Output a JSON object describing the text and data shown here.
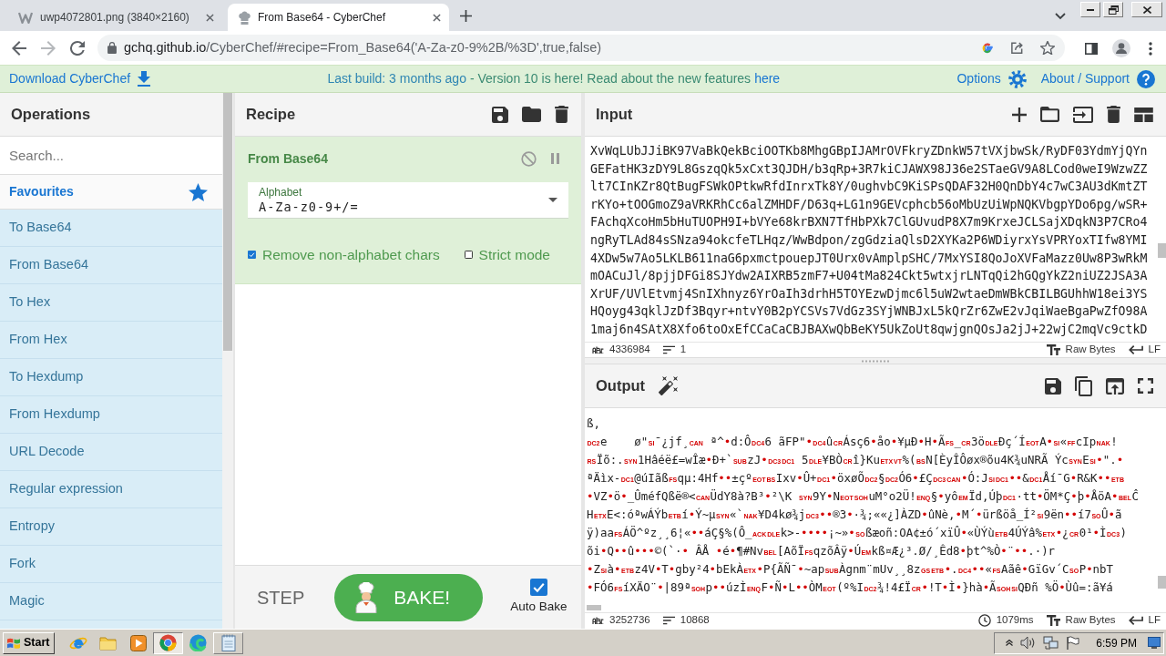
{
  "browser": {
    "tabs": [
      {
        "kind": "image",
        "title": "uwp4072801.png (3840×2160)",
        "selected": false
      },
      {
        "kind": "site",
        "title": "From Base64 - CyberChef",
        "selected": true
      }
    ],
    "address": {
      "host": "gchq.github.io",
      "path": "/CyberChef/#recipe=From_Base64('A-Za-z0-9%2B/%3D',true,false)"
    }
  },
  "banner": {
    "download": "Download CyberChef",
    "build": "Last build: 3 months ago",
    "notice": "- Version 10 is here! Read about the new features",
    "notice_link": "here",
    "options": "Options",
    "about": "About / Support"
  },
  "operations": {
    "title": "Operations",
    "search": {
      "placeholder": "Search..."
    },
    "favourites": "Favourites",
    "items": [
      "To Base64",
      "From Base64",
      "To Hex",
      "From Hex",
      "To Hexdump",
      "From Hexdump",
      "URL Decode",
      "Regular expression",
      "Entropy",
      "Fork",
      "Magic"
    ]
  },
  "recipe": {
    "title": "Recipe",
    "steps": [
      {
        "name": "From Base64",
        "args": [
          {
            "kind": "select",
            "label": "Alphabet",
            "value": "A-Za-z0-9+/="
          },
          {
            "kind": "checkbox",
            "label": "Remove non-alphabet chars",
            "checked": true
          },
          {
            "kind": "checkbox",
            "label": "Strict mode",
            "checked": false
          }
        ]
      }
    ],
    "step": "STEP",
    "bake": "BAKE!",
    "auto_bake": {
      "label": "Auto Bake",
      "checked": true
    }
  },
  "input": {
    "title": "Input",
    "lines": [
      "XvWqLUbJJiBK97VaBkQekBciOOTKb8MhgGBpIJAMrOVFkryZDnkW57tVXjbwSk/RyDF03YdmYjQYn",
      "GEFatHK3zDY9L8GszqQk5xCxt3QJDH/b3qRp+3R7kiCJAWX98J36e2STaeGV9A8LCod0weI9WzwZZ",
      "lt7CInKZr8QtBugFSWkOPtkwRfdInrxTk8Y/0ughvbC9KiSPsQDAF32H0QnDbY4c7wC3AU3dKmtZT",
      "rKYo+tOOGmoZ9aVRKRhCc6alZMHDF/D63q+LG1n9GEVcphcb56oMbUzUiWpNQKVbgpYDo6pg/wSR+",
      "FAchqXcoHm5bHuTUOPH9I+bVYe68krBXN7TfHbPXk7ClGUvudP8X7m9KrxeJCLSajXDqkN3P7CRo4",
      "ngRyTLAd84sSNza94okcfeTLHqz/WwBdpon/zgGdziaQlsD2XYKa2P6WDiyrxYsVPRYoxTIfw8YMI",
      "4XDw5w7Ao5LKLB611naG6pxmctpouepJT0Urx0vAmplpSHC/7MxYSI8QoJoXVFaMazz0Uw8P3wRkM",
      "mOACuJl/8pjjDFGi8SJYdw2AIXRB5zmF7+U04tMa824Ckt5wtxjrLNTqQi2hGQgYkZ2niUZ2JSA3A",
      "XrUF/UVlEtvmj4SnIXhnyz6YrOaIh3drhH5TOYEzwDjmc6l5uW2wtaeDmWBkCBILBGUhhW18ei3YS",
      "HQoyg43qklJzDf3Bqyr+ntvY0B2pYCSVs7VdGz3SYjWNBJxL5kQrZr6ZwE2vJqiWaeBgaPwZfO98A",
      "1maj6n4SAtX8Xfo6toOxEfCCaCaCBJBAXwQbBeKY5UkZoUt8qwjgnQOsJa2jJ+22wjC2mqVc9ctkD"
    ],
    "status": {
      "length": "4336984",
      "lines": "1",
      "format": "Raw Bytes",
      "eol": "LF"
    }
  },
  "output": {
    "title": "Output",
    "lines": [
      [
        {
          "kind": "text",
          "text": "ß,"
        }
      ],
      [
        {
          "kind": "ctl",
          "text": "DC2"
        },
        {
          "kind": "text",
          "text": "e    ø\""
        },
        {
          "kind": "ctl",
          "text": "SI"
        },
        {
          "kind": "text",
          "text": "¯¿jf¸"
        },
        {
          "kind": "ctl",
          "text": "CAN"
        },
        {
          "kind": "text",
          "text": " ª^"
        },
        {
          "kind": "dot",
          "text": "•"
        },
        {
          "kind": "text",
          "text": "d:Ô"
        },
        {
          "kind": "ctl",
          "text": "DC4"
        },
        {
          "kind": "text",
          "text": "6 ãFP\""
        },
        {
          "kind": "dot",
          "text": "•"
        },
        {
          "kind": "ctl",
          "text": "DC4"
        },
        {
          "kind": "text",
          "text": "û"
        },
        {
          "kind": "ctl",
          "text": "CR"
        },
        {
          "kind": "text",
          "text": "Ásç6"
        },
        {
          "kind": "dot",
          "text": "•"
        },
        {
          "kind": "text",
          "text": "åo"
        },
        {
          "kind": "dot",
          "text": "•"
        },
        {
          "kind": "text",
          "text": "¥µÐ"
        },
        {
          "kind": "dot",
          "text": "•"
        },
        {
          "kind": "text",
          "text": "H"
        },
        {
          "kind": "dot",
          "text": "•"
        },
        {
          "kind": "text",
          "text": "Ã"
        },
        {
          "kind": "ctl",
          "text": "FS"
        },
        {
          "kind": "text",
          "text": "_"
        },
        {
          "kind": "ctl",
          "text": "CR"
        },
        {
          "kind": "text",
          "text": "3ö"
        },
        {
          "kind": "ctl",
          "text": "DLE"
        },
        {
          "kind": "text",
          "text": "Ðç´Í"
        },
        {
          "kind": "ctl",
          "text": "EOT"
        },
        {
          "kind": "text",
          "text": "A"
        },
        {
          "kind": "dot",
          "text": "•"
        },
        {
          "kind": "ctl",
          "text": "SI"
        },
        {
          "kind": "text",
          "text": "«"
        },
        {
          "kind": "ctl",
          "text": "FF"
        },
        {
          "kind": "text",
          "text": "cIp"
        },
        {
          "kind": "ctl",
          "text": "NAK"
        },
        {
          "kind": "text",
          "text": "!"
        }
      ],
      [
        {
          "kind": "ctl",
          "text": "RS"
        },
        {
          "kind": "text",
          "text": "Ïõ:."
        },
        {
          "kind": "ctl",
          "text": "SYN"
        },
        {
          "kind": "text",
          "text": "1Hâéë£=wÎæ"
        },
        {
          "kind": "dot",
          "text": "•"
        },
        {
          "kind": "text",
          "text": "Ð+`"
        },
        {
          "kind": "ctl",
          "text": "SUB"
        },
        {
          "kind": "text",
          "text": "zJ"
        },
        {
          "kind": "dot",
          "text": "•"
        },
        {
          "kind": "ctl",
          "text": "DC3"
        },
        {
          "kind": "ctl",
          "text": "DC1"
        },
        {
          "kind": "text",
          "text": " 5"
        },
        {
          "kind": "ctl",
          "text": "DLE"
        },
        {
          "kind": "text",
          "text": "¥BÒ"
        },
        {
          "kind": "ctl",
          "text": "CR"
        },
        {
          "kind": "text",
          "text": "î}Ku"
        },
        {
          "kind": "ctl",
          "text": "ETX"
        },
        {
          "kind": "ctl",
          "text": "VT"
        },
        {
          "kind": "text",
          "text": "%("
        },
        {
          "kind": "ctl",
          "text": "BS"
        },
        {
          "kind": "text",
          "text": "N[ÈyÎÔøx®õu4K¾uNRÃ Ýc"
        },
        {
          "kind": "ctl",
          "text": "SYN"
        },
        {
          "kind": "text",
          "text": "E"
        },
        {
          "kind": "ctl",
          "text": "SI"
        },
        {
          "kind": "dot",
          "text": "•"
        },
        {
          "kind": "text",
          "text": "\"."
        },
        {
          "kind": "dot",
          "text": "•"
        }
      ],
      [
        {
          "kind": "text",
          "text": "ªÄìx-"
        },
        {
          "kind": "ctl",
          "text": "DC1"
        },
        {
          "kind": "text",
          "text": "@úIãß"
        },
        {
          "kind": "ctl",
          "text": "FS"
        },
        {
          "kind": "text",
          "text": "qµ:4Hf"
        },
        {
          "kind": "dot",
          "text": "••"
        },
        {
          "kind": "text",
          "text": "±çº"
        },
        {
          "kind": "ctl",
          "text": "EOT"
        },
        {
          "kind": "ctl",
          "text": "BS"
        },
        {
          "kind": "text",
          "text": "Ixv"
        },
        {
          "kind": "dot",
          "text": "•"
        },
        {
          "kind": "text",
          "text": "Û+"
        },
        {
          "kind": "ctl",
          "text": "DC1"
        },
        {
          "kind": "dot",
          "text": "•"
        },
        {
          "kind": "text",
          "text": "öxøÕ"
        },
        {
          "kind": "ctl",
          "text": "DC2"
        },
        {
          "kind": "text",
          "text": "§"
        },
        {
          "kind": "ctl",
          "text": "DC2"
        },
        {
          "kind": "text",
          "text": "Ó6"
        },
        {
          "kind": "dot",
          "text": "•"
        },
        {
          "kind": "text",
          "text": "£Ç"
        },
        {
          "kind": "ctl",
          "text": "DC3"
        },
        {
          "kind": "ctl",
          "text": "CAN"
        },
        {
          "kind": "dot",
          "text": "•"
        },
        {
          "kind": "text",
          "text": "Ó:J"
        },
        {
          "kind": "ctl",
          "text": "SI"
        },
        {
          "kind": "ctl",
          "text": "DC1"
        },
        {
          "kind": "dot",
          "text": "••"
        },
        {
          "kind": "text",
          "text": "&"
        },
        {
          "kind": "ctl",
          "text": "DC1"
        },
        {
          "kind": "text",
          "text": "Åí¯G"
        },
        {
          "kind": "dot",
          "text": "•"
        },
        {
          "kind": "text",
          "text": "R&K"
        },
        {
          "kind": "dot",
          "text": "••"
        },
        {
          "kind": "ctl",
          "text": "ETB"
        }
      ],
      [
        {
          "kind": "dot",
          "text": "•"
        },
        {
          "kind": "text",
          "text": "VZ"
        },
        {
          "kind": "dot",
          "text": "•"
        },
        {
          "kind": "text",
          "text": "ö"
        },
        {
          "kind": "dot",
          "text": "•"
        },
        {
          "kind": "text",
          "text": "_ÛméfQßë®<"
        },
        {
          "kind": "ctl",
          "text": "CAN"
        },
        {
          "kind": "text",
          "text": "ÜdY8à?B³"
        },
        {
          "kind": "dot",
          "text": "•"
        },
        {
          "kind": "text",
          "text": "²\\K "
        },
        {
          "kind": "ctl",
          "text": "SYN"
        },
        {
          "kind": "text",
          "text": "9Y"
        },
        {
          "kind": "dot",
          "text": "•"
        },
        {
          "kind": "text",
          "text": "N"
        },
        {
          "kind": "ctl",
          "text": "EOT"
        },
        {
          "kind": "ctl",
          "text": "SOH"
        },
        {
          "kind": "text",
          "text": "uM°o2Ü!"
        },
        {
          "kind": "ctl",
          "text": "ENQ"
        },
        {
          "kind": "text",
          "text": "§"
        },
        {
          "kind": "dot",
          "text": "•"
        },
        {
          "kind": "text",
          "text": "yô"
        },
        {
          "kind": "ctl",
          "text": "EM"
        },
        {
          "kind": "text",
          "text": "Ïd,Úþ"
        },
        {
          "kind": "ctl",
          "text": "DC1"
        },
        {
          "kind": "text",
          "text": "·tt"
        },
        {
          "kind": "dot",
          "text": "•"
        },
        {
          "kind": "text",
          "text": "ÖM*Ç"
        },
        {
          "kind": "dot",
          "text": "•"
        },
        {
          "kind": "text",
          "text": "þ"
        },
        {
          "kind": "dot",
          "text": "•"
        },
        {
          "kind": "text",
          "text": "ÅöA"
        },
        {
          "kind": "dot",
          "text": "•"
        },
        {
          "kind": "ctl",
          "text": "BEL"
        },
        {
          "kind": "text",
          "text": "Ĉ"
        }
      ],
      [
        {
          "kind": "text",
          "text": "H"
        },
        {
          "kind": "ctl",
          "text": "ETX"
        },
        {
          "kind": "text",
          "text": "E<:óªwÁÝb"
        },
        {
          "kind": "ctl",
          "text": "ETB"
        },
        {
          "kind": "text",
          "text": "í"
        },
        {
          "kind": "dot",
          "text": "•"
        },
        {
          "kind": "text",
          "text": "Ý~µ"
        },
        {
          "kind": "ctl",
          "text": "SYN"
        },
        {
          "kind": "text",
          "text": "«`"
        },
        {
          "kind": "ctl",
          "text": "NAK"
        },
        {
          "kind": "text",
          "text": "¥D4kø¾j"
        },
        {
          "kind": "ctl",
          "text": "DC3"
        },
        {
          "kind": "dot",
          "text": "••"
        },
        {
          "kind": "text",
          "text": "®3"
        },
        {
          "kind": "dot",
          "text": "•"
        },
        {
          "kind": "text",
          "text": "·¾;««¿]ÀZD"
        },
        {
          "kind": "dot",
          "text": "•"
        },
        {
          "kind": "text",
          "text": "ûNè,"
        },
        {
          "kind": "dot",
          "text": "•"
        },
        {
          "kind": "text",
          "text": "M´"
        },
        {
          "kind": "dot",
          "text": "•"
        },
        {
          "kind": "text",
          "text": "ürßöå_Í²"
        },
        {
          "kind": "ctl",
          "text": "SI"
        },
        {
          "kind": "text",
          "text": "9ën"
        },
        {
          "kind": "dot",
          "text": "••"
        },
        {
          "kind": "text",
          "text": "í7"
        },
        {
          "kind": "ctl",
          "text": "SO"
        },
        {
          "kind": "text",
          "text": "Û"
        },
        {
          "kind": "dot",
          "text": "•"
        },
        {
          "kind": "text",
          "text": "ã"
        }
      ],
      [
        {
          "kind": "text",
          "text": "ÿ)aa"
        },
        {
          "kind": "ctl",
          "text": "FS"
        },
        {
          "kind": "text",
          "text": "ÁÖ^ºz¸¸6¦«"
        },
        {
          "kind": "dot",
          "text": "••"
        },
        {
          "kind": "text",
          "text": "áÇ§%(Ô_"
        },
        {
          "kind": "ctl",
          "text": "ACK"
        },
        {
          "kind": "ctl",
          "text": "DLE"
        },
        {
          "kind": "text",
          "text": "k>-"
        },
        {
          "kind": "dot",
          "text": "••••"
        },
        {
          "kind": "text",
          "text": "¡~»"
        },
        {
          "kind": "dot",
          "text": "•"
        },
        {
          "kind": "ctl",
          "text": "SO"
        },
        {
          "kind": "text",
          "text": "ßæoñ:OA¢±ó´xïÛ"
        },
        {
          "kind": "dot",
          "text": "•"
        },
        {
          "kind": "text",
          "text": "«ÙÝù"
        },
        {
          "kind": "ctl",
          "text": "ETB"
        },
        {
          "kind": "text",
          "text": "4ÚÝâ%"
        },
        {
          "kind": "ctl",
          "text": "ETX"
        },
        {
          "kind": "dot",
          "text": "•"
        },
        {
          "kind": "text",
          "text": "¿"
        },
        {
          "kind": "ctl",
          "text": "CR"
        },
        {
          "kind": "text",
          "text": "0¹"
        },
        {
          "kind": "dot",
          "text": "•"
        },
        {
          "kind": "text",
          "text": "Ì"
        },
        {
          "kind": "ctl",
          "text": "DC3"
        },
        {
          "kind": "text",
          "text": ")"
        }
      ],
      [
        {
          "kind": "text",
          "text": "õi"
        },
        {
          "kind": "dot",
          "text": "•"
        },
        {
          "kind": "text",
          "text": "Q"
        },
        {
          "kind": "dot",
          "text": "••"
        },
        {
          "kind": "text",
          "text": "û"
        },
        {
          "kind": "dot",
          "text": "•••"
        },
        {
          "kind": "text",
          "text": "©(`·"
        },
        {
          "kind": "dot",
          "text": "•"
        },
        {
          "kind": "text",
          "text": " ÂÅ "
        },
        {
          "kind": "dot",
          "text": "•"
        },
        {
          "kind": "text",
          "text": "é"
        },
        {
          "kind": "dot",
          "text": "•"
        },
        {
          "kind": "text",
          "text": "¶#Nv"
        },
        {
          "kind": "ctl",
          "text": "BEL"
        },
        {
          "kind": "text",
          "text": "[AõÏ"
        },
        {
          "kind": "ctl",
          "text": "FS"
        },
        {
          "kind": "text",
          "text": "qzõÂÿ"
        },
        {
          "kind": "dot",
          "text": "•"
        },
        {
          "kind": "text",
          "text": "Ú"
        },
        {
          "kind": "ctl",
          "text": "EM"
        },
        {
          "kind": "text",
          "text": "kß¤Æ¿³.Ø/¸Êd8"
        },
        {
          "kind": "dot",
          "text": "•"
        },
        {
          "kind": "text",
          "text": "þt^%Ò"
        },
        {
          "kind": "dot",
          "text": "•"
        },
        {
          "kind": "text",
          "text": "¨"
        },
        {
          "kind": "dot",
          "text": "••"
        },
        {
          "kind": "text",
          "text": ".·)r"
        }
      ],
      [
        {
          "kind": "dot",
          "text": "•"
        },
        {
          "kind": "text",
          "text": "Z"
        },
        {
          "kind": "ctl",
          "text": "SI"
        },
        {
          "kind": "text",
          "text": "à"
        },
        {
          "kind": "dot",
          "text": "•"
        },
        {
          "kind": "ctl",
          "text": "ETB"
        },
        {
          "kind": "text",
          "text": "z4V"
        },
        {
          "kind": "dot",
          "text": "•"
        },
        {
          "kind": "text",
          "text": "T"
        },
        {
          "kind": "dot",
          "text": "•"
        },
        {
          "kind": "text",
          "text": "gby²4"
        },
        {
          "kind": "dot",
          "text": "•"
        },
        {
          "kind": "text",
          "text": "bEkÀ"
        },
        {
          "kind": "ctl",
          "text": "ETX"
        },
        {
          "kind": "dot",
          "text": "•"
        },
        {
          "kind": "text",
          "text": "P{ÃÑ¯"
        },
        {
          "kind": "dot",
          "text": "•"
        },
        {
          "kind": "text",
          "text": "~ap"
        },
        {
          "kind": "ctl",
          "text": "SUB"
        },
        {
          "kind": "text",
          "text": "Àgnm¨mUv¸¸8z"
        },
        {
          "kind": "ctl",
          "text": "GS"
        },
        {
          "kind": "ctl",
          "text": "ETB"
        },
        {
          "kind": "dot",
          "text": "•"
        },
        {
          "kind": "text",
          "text": "."
        },
        {
          "kind": "ctl",
          "text": "DC4"
        },
        {
          "kind": "dot",
          "text": "••"
        },
        {
          "kind": "text",
          "text": "«"
        },
        {
          "kind": "ctl",
          "text": "FS"
        },
        {
          "kind": "text",
          "text": "Aãê"
        },
        {
          "kind": "dot",
          "text": "•"
        },
        {
          "kind": "text",
          "text": "GïGv´C"
        },
        {
          "kind": "ctl",
          "text": "SO"
        },
        {
          "kind": "text",
          "text": "P"
        },
        {
          "kind": "dot",
          "text": "•"
        },
        {
          "kind": "text",
          "text": "nbT"
        }
      ],
      [
        {
          "kind": "dot",
          "text": "•"
        },
        {
          "kind": "text",
          "text": "FÓ6"
        },
        {
          "kind": "ctl",
          "text": "FS"
        },
        {
          "kind": "text",
          "text": "íXÄO¨"
        },
        {
          "kind": "dot",
          "text": "•"
        },
        {
          "kind": "text",
          "text": "|89ª"
        },
        {
          "kind": "ctl",
          "text": "SOH"
        },
        {
          "kind": "text",
          "text": "p"
        },
        {
          "kind": "dot",
          "text": "••"
        },
        {
          "kind": "text",
          "text": "úzÌ"
        },
        {
          "kind": "ctl",
          "text": "ENQ"
        },
        {
          "kind": "text",
          "text": "F"
        },
        {
          "kind": "dot",
          "text": "•"
        },
        {
          "kind": "text",
          "text": "Ñ"
        },
        {
          "kind": "dot",
          "text": "•"
        },
        {
          "kind": "text",
          "text": "L"
        },
        {
          "kind": "dot",
          "text": "••"
        },
        {
          "kind": "text",
          "text": "ÒM"
        },
        {
          "kind": "ctl",
          "text": "EOT"
        },
        {
          "kind": "text",
          "text": "(º%I"
        },
        {
          "kind": "ctl",
          "text": "DC2"
        },
        {
          "kind": "text",
          "text": "¾!4£Ï"
        },
        {
          "kind": "ctl",
          "text": "CR"
        },
        {
          "kind": "dot",
          "text": "•"
        },
        {
          "kind": "text",
          "text": "!T"
        },
        {
          "kind": "dot",
          "text": "•"
        },
        {
          "kind": "text",
          "text": "Ì"
        },
        {
          "kind": "dot",
          "text": "•"
        },
        {
          "kind": "text",
          "text": "}hà"
        },
        {
          "kind": "dot",
          "text": "•"
        },
        {
          "kind": "text",
          "text": "Ã"
        },
        {
          "kind": "ctl",
          "text": "SOH"
        },
        {
          "kind": "ctl",
          "text": "SI"
        },
        {
          "kind": "text",
          "text": "QÐñ %Ö"
        },
        {
          "kind": "dot",
          "text": "•"
        },
        {
          "kind": "text",
          "text": "Ùû=:ã¥á"
        }
      ]
    ],
    "status": {
      "length": "3252736",
      "lines": "10868",
      "time": "1079ms",
      "format": "Raw Bytes",
      "eol": "LF"
    }
  },
  "taskbar": {
    "start": "Start",
    "apps": [
      {
        "kind": "ie",
        "open": false,
        "selected": false
      },
      {
        "kind": "folder",
        "open": false,
        "selected": false
      },
      {
        "kind": "media",
        "open": false,
        "selected": false
      },
      {
        "kind": "chrome",
        "open": true,
        "selected": true
      },
      {
        "kind": "edge",
        "open": false,
        "selected": false
      },
      {
        "kind": "notepad",
        "open": true,
        "selected": false
      }
    ],
    "clock": "6:59 PM"
  }
}
